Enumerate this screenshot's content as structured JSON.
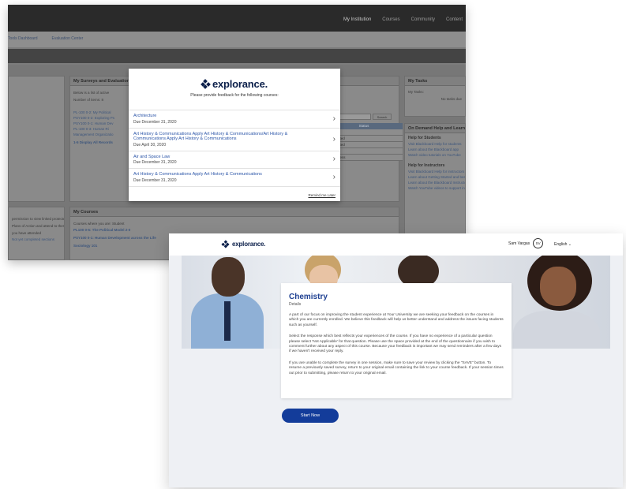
{
  "lms": {
    "top_nav": [
      "My Institution",
      "Courses",
      "Community",
      "Content"
    ],
    "sub_nav": [
      "Tools Dashboard",
      "Evaluation Center"
    ],
    "panels": {
      "left_top": {
        "title": "",
        "lines": []
      },
      "surveys": {
        "title": "My Surveys and Evaluations",
        "lines": [
          "Below is a list of active",
          "Number of items: 8"
        ],
        "links": [
          "PL-100 0-2: My Political",
          "PSY100 0-2: Exploring Ps",
          "PSY100 0-1: Human Dev",
          "PL-100 0-3: Human Ri",
          "Management Organizatio"
        ],
        "more": "1-5 Display All Records"
      },
      "tasks": {
        "title": "My Tasks",
        "lines": [
          "My Tasks:",
          "No tasks due"
        ]
      },
      "on_demand": {
        "title": "On Demand Help and Learning",
        "sections": [
          {
            "bold": "Help for Students",
            "links": [
              "Visit Blackboard Help for students",
              "Learn about the Blackboard app",
              "Watch video tutorials on YouTube"
            ]
          },
          {
            "bold": "Help for Instructors",
            "links": [
              "Visit Blackboard Help for instructors",
              "Learn about Getting Started and best practices",
              "Learn about the Blackboard Instructor app",
              "Watch YouTube videos to support instruction"
            ]
          }
        ]
      },
      "courses": {
        "title": "My Courses",
        "lines": [
          "Courses where you are: Student"
        ],
        "courses": [
          "PL100 0-5: The Political Model 2-0",
          "PSY100 0-1: Human Development across the Life",
          "Sociology 101"
        ]
      },
      "left_bottom": {
        "lines": [
          "permission to view linked protected",
          "Plans of Action and attend to these",
          "you have attended"
        ],
        "link": "Not yet completed sections"
      }
    },
    "status_table": {
      "header": "Status",
      "rows": [
        "Open",
        "Completed",
        "Completed",
        "Open",
        "In progress"
      ]
    },
    "search_button": "Search"
  },
  "modal": {
    "brand": "explorance.",
    "subtitle": "Please provide feedback for the following courses:",
    "courses": [
      {
        "name": "Architecture",
        "due": "Due December 31, 2020"
      },
      {
        "name": "Art History & Communications Apply Art History & Communications/Art History & Communications Apply Art History & Communications",
        "due": "Due April 30, 2020"
      },
      {
        "name": "Air and Space Law",
        "due": "Due December 31, 2020"
      },
      {
        "name": "Art History & Communications Apply Art History & Communications",
        "due": "Due December 31, 2020"
      }
    ],
    "remind_label": "Remind me Later"
  },
  "survey": {
    "brand": "explorance.",
    "user_name": "Sam Vargas",
    "user_initials": "SV",
    "language": "English",
    "title": "Chemistry",
    "subtitle": "Details",
    "paragraphs": [
      "A part of our focus on improving the student experience at Your University we are seeking your feedback on the courses in which you are currently enrolled. We believe this feedback will help us better understand and address the issues facing students such as yourself.",
      "Select the response which best reflects your experiences of the course. If you have no experience of a particular question please select 'Not Applicable' for that question. Please use the space provided at the end of the questionnaire if you wish to comment further about any aspect of this course. Because your feedback is important we may send reminders after a few days if we haven't received your reply.",
      "If you are unable to complete the survey in one session, make sure to save your review by clicking the \"SAVE\" button. To resume a previously saved survey, return to your original email containing the link to your course feedback. If your session times out prior to submitting, please return to your original email."
    ],
    "start_label": "Start Now"
  },
  "colors": {
    "brand_navy": "#0b1f4a",
    "button_blue": "#133c9a",
    "link_blue": "#2b55a8"
  }
}
